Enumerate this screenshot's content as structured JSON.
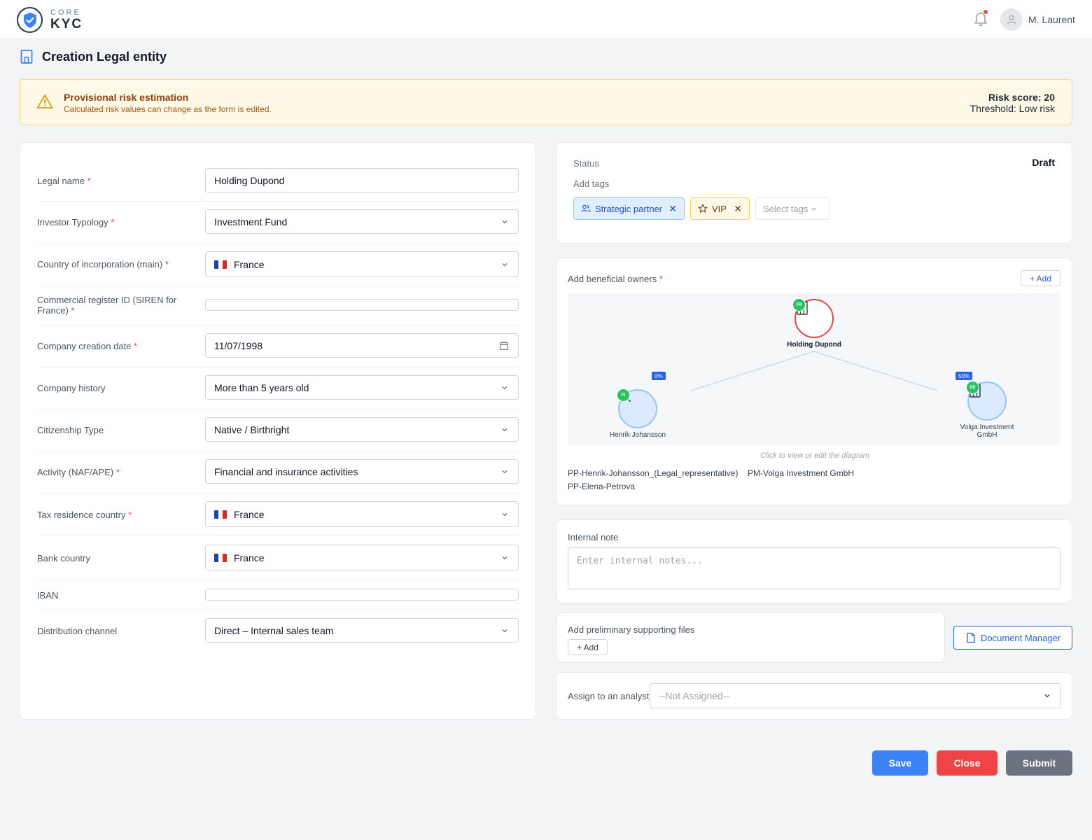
{
  "header": {
    "logo_top": "CORE",
    "logo_bottom": "KYC",
    "user_name": "M. Laurent",
    "accent_color": "#2563eb"
  },
  "page": {
    "title": "Creation Legal entity"
  },
  "banner": {
    "title": "Provisional risk estimation",
    "subtitle": "Calculated risk values can change as the form is edited.",
    "score": "Risk score: 20",
    "threshold": "Threshold: Low risk"
  },
  "form": {
    "legal_name": {
      "label": "Legal name",
      "value": "Holding Dupond"
    },
    "investor_typology": {
      "label": "Investor Typology",
      "value": "Investment Fund"
    },
    "country_incorporation": {
      "label": "Country of incorporation (main)",
      "value": "France"
    },
    "commercial_register": {
      "label": "Commercial register ID (SIREN for France)",
      "value": ""
    },
    "creation_date": {
      "label": "Company creation date",
      "value": "11/07/1998"
    },
    "company_history": {
      "label": "Company history",
      "value": "More than 5 years old"
    },
    "citizenship_type": {
      "label": "Citizenship Type",
      "value": "Native / Birthright"
    },
    "activity": {
      "label": "Activity (NAF/APE)",
      "value": "Financial and insurance activities"
    },
    "tax_residence": {
      "label": "Tax residence country",
      "value": "France"
    },
    "bank_country": {
      "label": "Bank country",
      "value": "France"
    },
    "iban": {
      "label": "IBAN",
      "value": ""
    },
    "distribution_channel": {
      "label": "Distribution channel",
      "value": "Direct – Internal sales team"
    },
    "required_mark": "*"
  },
  "status": {
    "label": "Status",
    "value": "Draft",
    "tags_label": "Add tags",
    "tags": [
      "Strategic partner",
      "VIP"
    ],
    "tag_remove": "✕",
    "tags_placeholder": "Select tags"
  },
  "owners": {
    "label": "Add beneficial owners",
    "add_label": "+ Add",
    "diagram": {
      "main": {
        "name": "Holding Dupond",
        "country": "FR"
      },
      "left": {
        "name": "Henrik Johansson",
        "country": "FI",
        "percent": "0%"
      },
      "right": {
        "name_line1": "Volga Investment",
        "name_line2": "GmbH",
        "country": "DE",
        "percent": "50%"
      },
      "hint": "Click to view or edit the diagram"
    },
    "list": [
      "PP-Henrik-Johansson_(Legal_representative)",
      "PM-Volga Investment GmbH",
      "PP-Elena-Petrova"
    ]
  },
  "note": {
    "label": "Internal note",
    "placeholder": "Enter internal notes..."
  },
  "files": {
    "label": "Add preliminary supporting files",
    "add_label": "+ Add",
    "document_manager": "Document Manager"
  },
  "assign": {
    "label": "Assign to an analyst",
    "value": "--Not Assigned--"
  },
  "actions": {
    "save": "Save",
    "close": "Close",
    "submit": "Submit"
  }
}
